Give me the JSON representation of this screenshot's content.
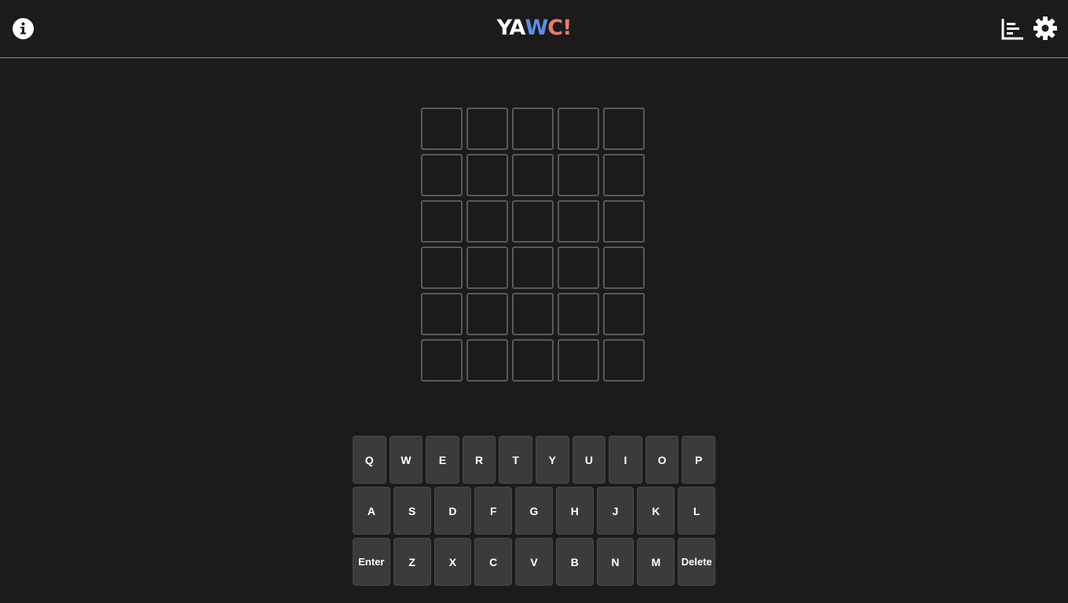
{
  "header": {
    "title_parts": [
      {
        "text": "YA",
        "color": "#ffffff"
      },
      {
        "text": "W",
        "color": "#5b8ee6"
      },
      {
        "text": "C!",
        "color": "#e77d6c"
      }
    ],
    "info_icon": "info-icon",
    "stats_icon": "bar-chart-icon",
    "settings_icon": "gear-icon"
  },
  "grid": {
    "rows": [
      [
        "",
        "",
        "",
        "",
        ""
      ],
      [
        "",
        "",
        "",
        "",
        ""
      ],
      [
        "",
        "",
        "",
        "",
        ""
      ],
      [
        "",
        "",
        "",
        "",
        ""
      ],
      [
        "",
        "",
        "",
        "",
        ""
      ],
      [
        "",
        "",
        "",
        "",
        ""
      ]
    ]
  },
  "keyboard": {
    "row1": [
      "Q",
      "W",
      "E",
      "R",
      "T",
      "Y",
      "U",
      "I",
      "O",
      "P"
    ],
    "row2": [
      "A",
      "S",
      "D",
      "F",
      "G",
      "H",
      "J",
      "K",
      "L"
    ],
    "row3": [
      "Enter",
      "Z",
      "X",
      "C",
      "V",
      "B",
      "N",
      "M",
      "Delete"
    ]
  },
  "colors": {
    "background": "#1c1a1b",
    "tile_border": "#5a5858",
    "key_background": "#3d3a3c"
  }
}
